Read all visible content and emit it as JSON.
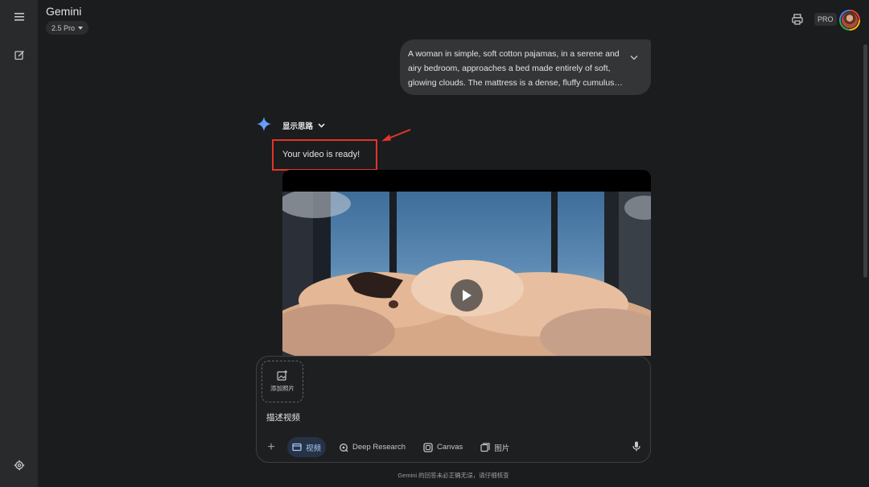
{
  "app": {
    "title": "Gemini",
    "model_label": "2.5 Pro",
    "pro_badge": "PRO"
  },
  "sidebar": {
    "items": [
      {
        "icon": "menu-icon"
      },
      {
        "icon": "new-chat-icon"
      },
      {
        "icon": "settings-icon"
      }
    ]
  },
  "conversation": {
    "user_prompt": "A woman in simple, soft cotton pajamas, in a serene and airy bedroom, approaches a bed made entirely of soft, glowing clouds. The mattress is a dense, fluffy cumulus…",
    "thinking_label": "显示思路",
    "response_text": "Your video is ready!"
  },
  "composer": {
    "add_photo_label": "添加照片",
    "input_placeholder": "描述视频",
    "tools": [
      {
        "label": "视频",
        "icon": "video-icon",
        "active": true
      },
      {
        "label": "Deep Research",
        "icon": "deep-research-icon",
        "active": false
      },
      {
        "label": "Canvas",
        "icon": "canvas-icon",
        "active": false
      },
      {
        "label": "图片",
        "icon": "image-icon",
        "active": false
      }
    ]
  },
  "footer": {
    "disclaimer": "Gemini 的回答未必正确无误，请仔细核查"
  },
  "colors": {
    "background": "#1b1c1d",
    "sidebar": "#282a2c",
    "accent_blue": "#a8c7fa",
    "annotation_red": "#e5332a"
  }
}
